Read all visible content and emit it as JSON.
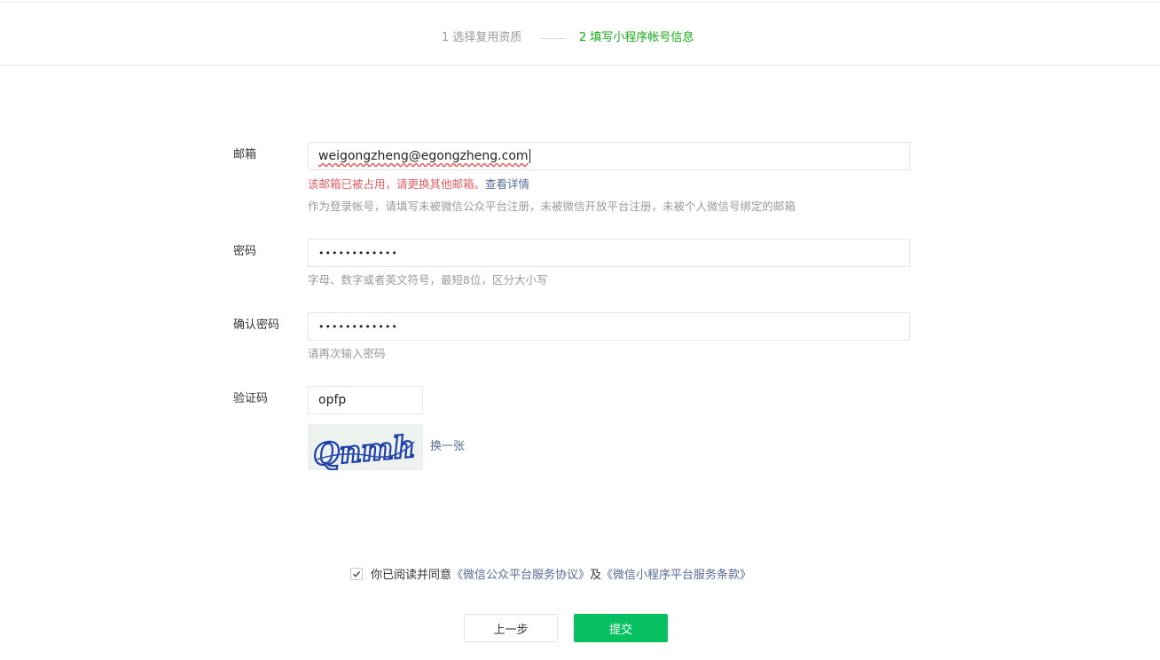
{
  "steps": {
    "step1": "1 选择复用资质",
    "step2": "2 填写小程序帐号信息"
  },
  "form": {
    "email": {
      "label": "邮箱",
      "value": "weigongzheng@egongzheng.com",
      "error": "该邮箱已被占用，请更换其他邮箱。",
      "error_link": "查看详情",
      "tip": "作为登录帐号，请填写未被微信公众平台注册，未被微信开放平台注册，未被个人微信号绑定的邮箱"
    },
    "password": {
      "label": "密码",
      "value": "••••••••••••",
      "tip": "字母、数字或者英文符号，最短8位，区分大小写"
    },
    "confirm_password": {
      "label": "确认密码",
      "value": "••••••••••••",
      "tip": "请再次输入密码"
    },
    "captcha": {
      "label": "验证码",
      "value": "opfp",
      "image_text": "Qnmh",
      "refresh": "换一张"
    }
  },
  "agreement": {
    "checked": true,
    "prefix": "你已阅读并同意",
    "link1": "《微信公众平台服务协议》",
    "and": "及",
    "link2": "《微信小程序平台服务条款》"
  },
  "buttons": {
    "prev": "上一步",
    "submit": "提交"
  },
  "colors": {
    "accent": "#07c160",
    "step_active": "#1aad19",
    "error": "#e15f63",
    "link": "#576b95"
  }
}
